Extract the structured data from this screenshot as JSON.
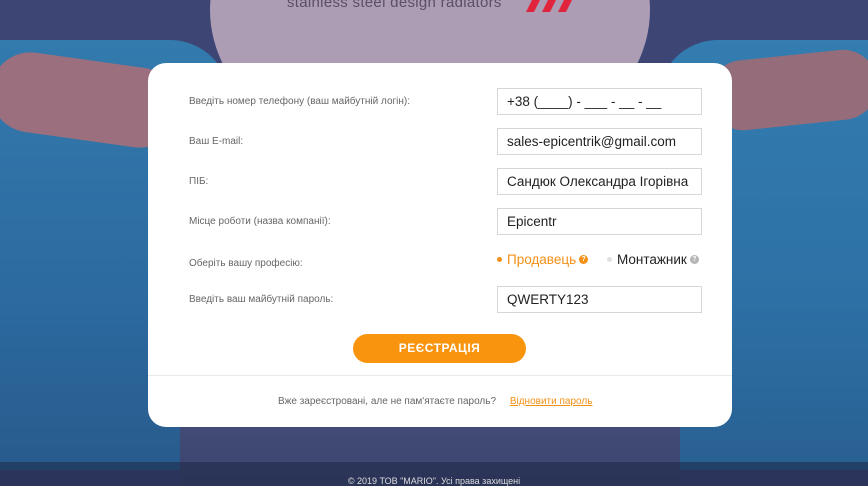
{
  "header": {
    "tagline": "stainless steel design radiators"
  },
  "form": {
    "phone": {
      "label": "Введіть номер телефону (ваш майбутній логін):",
      "value": "+38 (____) - ___ - __ - __"
    },
    "email": {
      "label": "Ваш E-mail:",
      "value": "sales-epicentrik@gmail.com"
    },
    "name": {
      "label": "ПІБ:",
      "value": "Сандюк Олександра Ігорівна"
    },
    "company": {
      "label": "Місце роботи (назва компанії):",
      "value": "Epicentr"
    },
    "profession": {
      "label": "Оберіть вашу професію:",
      "options": [
        "Продавець",
        "Монтажник"
      ],
      "selected": "Продавець",
      "help_glyph": "?"
    },
    "password": {
      "label": "Введіть ваш майбутній пароль:",
      "value": "QWERTY123"
    },
    "submit_label": "РЕЄСТРАЦІЯ"
  },
  "footer": {
    "question": "Вже зареєстровані, але не пам'ятаєте пароль?",
    "restore_link": "Відновити пароль",
    "copyright": "© 2019 ТОВ \"MARIO\". Усі права захищені"
  },
  "colors": {
    "accent": "#f9940f",
    "text": "#222222",
    "label": "#666666"
  }
}
